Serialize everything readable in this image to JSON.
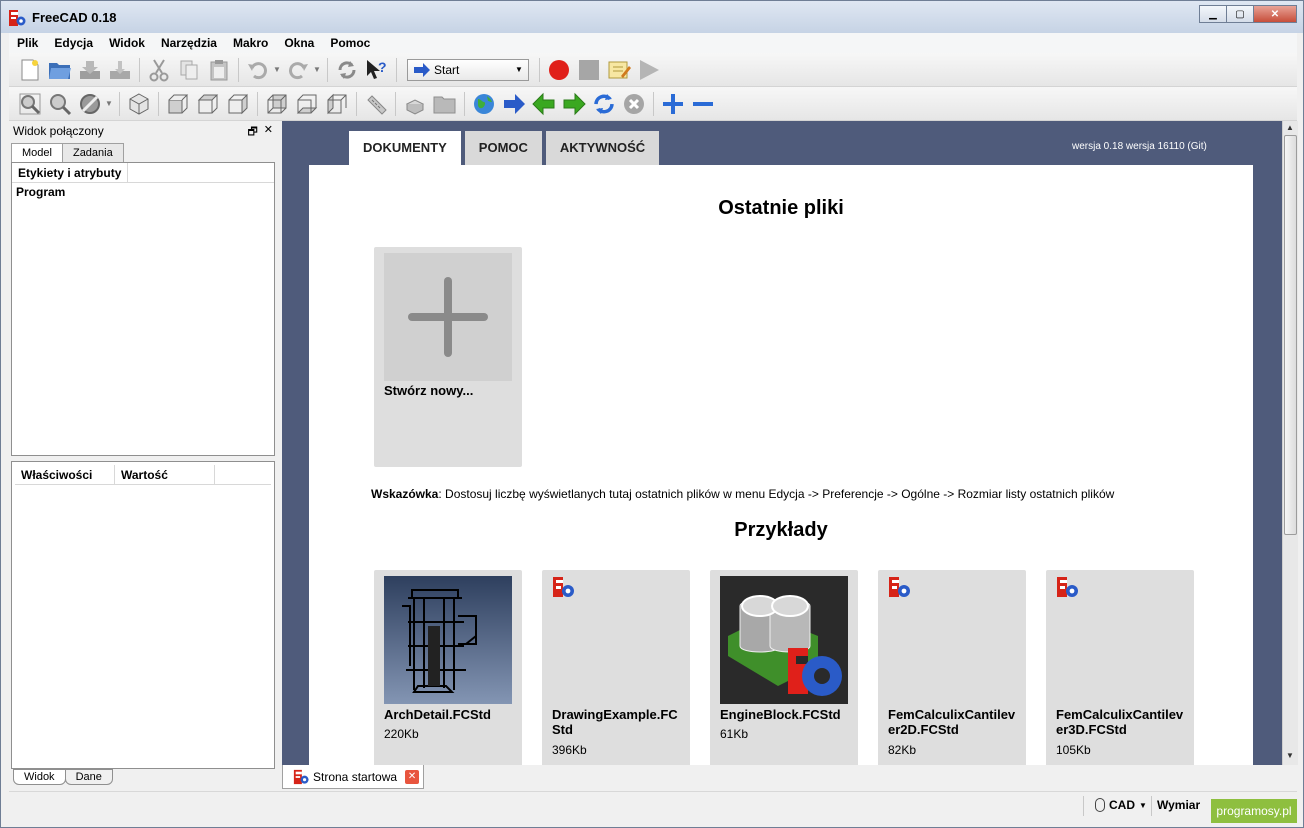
{
  "window": {
    "title": "FreeCAD 0.18",
    "controls": {
      "minimize": "▁",
      "maximize": "▢",
      "close": "✕"
    }
  },
  "menu": [
    "Plik",
    "Edycja",
    "Widok",
    "Narzędzia",
    "Makro",
    "Okna",
    "Pomoc"
  ],
  "toolbar": {
    "workbench_selected": "Start"
  },
  "combo_view": {
    "title": "Widok połączony",
    "float_glyph": "🗗",
    "close_glyph": "✕",
    "tabs": [
      "Model",
      "Zadania"
    ],
    "tree_header": "Etykiety i atrybuty",
    "tree_root": "Program",
    "property_headers": [
      "Właściwości",
      "Wartość"
    ],
    "bottom_tabs": [
      "Widok",
      "Dane"
    ]
  },
  "start_page": {
    "tabs": [
      "DOKUMENTY",
      "POMOC",
      "AKTYWNOŚĆ"
    ],
    "version": "wersja 0.18 wersja 16110 (Git)",
    "recent_title": "Ostatnie pliki",
    "create_new": "Stwórz nowy...",
    "hint_label": "Wskazówka",
    "hint_text": ": Dostosuj liczbę wyświetlanych tutaj ostatnich plików w menu Edycja -> Preferencje -> Ogólne -> Rozmiar listy ostatnich plików",
    "examples_title": "Przykłady",
    "examples": [
      {
        "name": "ArchDetail.FCStd",
        "size": "220Kb"
      },
      {
        "name": "DrawingExample.FCStd",
        "size": "396Kb"
      },
      {
        "name": "EngineBlock.FCStd",
        "size": "61Kb"
      },
      {
        "name": "FemCalculixCantilever2D.FCStd",
        "size": "82Kb"
      },
      {
        "name": "FemCalculixCantilever3D.FCStd",
        "size": "105Kb"
      }
    ]
  },
  "document_tab": {
    "label": "Strona startowa",
    "close": "✕"
  },
  "status": {
    "nav_style": "CAD",
    "units": "Wymiar"
  },
  "watermark": "programosy.pl",
  "colors": {
    "mdi_background": "#4f5b7b",
    "record": "#e0201a",
    "nav_green": "#3aa820",
    "zoom_blue": "#2a6bd6"
  }
}
